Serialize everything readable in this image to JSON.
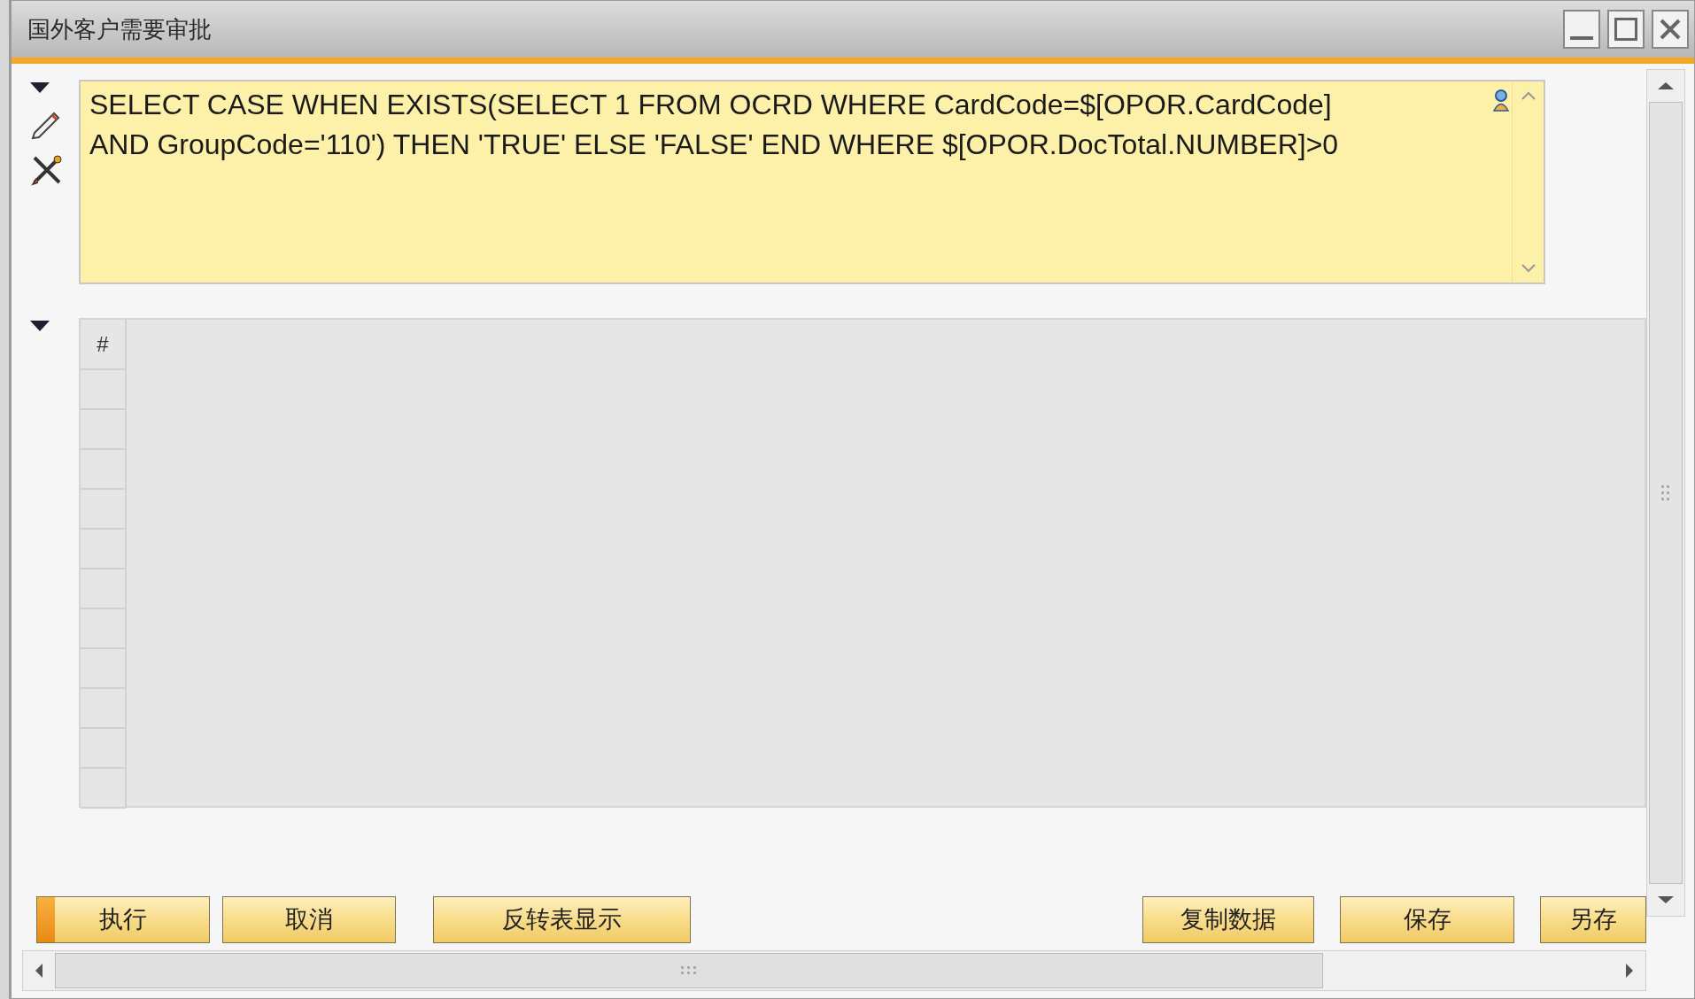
{
  "window": {
    "title": "国外客户需要审批"
  },
  "query": {
    "lines": [
      "SELECT CASE WHEN EXISTS(SELECT 1 FROM OCRD WHERE CardCode=$[OPOR.CardCode]",
      "AND GroupCode='110') THEN 'TRUE' ELSE 'FALSE' END WHERE $[OPOR.DocTotal.NUMBER]>0"
    ],
    "expanded": true
  },
  "grid": {
    "expanded": true,
    "columns": [
      "#"
    ]
  },
  "buttons": [
    {
      "label": "执行",
      "default": true
    },
    {
      "label": "取消",
      "default": false
    },
    {
      "label": "反转表显示",
      "default": false
    },
    {
      "label": "复制数据",
      "default": false
    },
    {
      "label": "保存",
      "default": false
    },
    {
      "label": "另存",
      "default": false
    }
  ]
}
